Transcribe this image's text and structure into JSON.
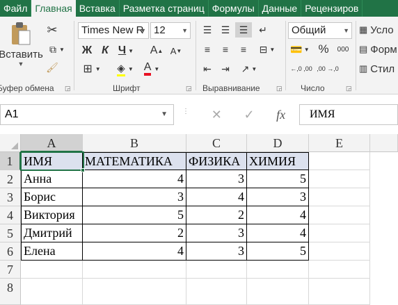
{
  "tabs": [
    "Файл",
    "Главная",
    "Вставка",
    "Разметка страниц",
    "Формулы",
    "Данные",
    "Рецензиров"
  ],
  "clipboard": {
    "paste_label": "Вставить",
    "group_label": "Буфер обмена"
  },
  "font": {
    "name": "Times New R",
    "size": "12",
    "bold": "Ж",
    "italic": "К",
    "underline": "Ч",
    "grow": "A",
    "shrink": "A",
    "color_letter": "A",
    "group_label": "Шрифт",
    "font_color": "#e81123"
  },
  "alignment": {
    "group_label": "Выравнивание"
  },
  "number": {
    "format": "Общий",
    "percent": "%",
    "comma": "000",
    "inc_dec": "←,0 ,00",
    "dec_dec": ",00 →,0",
    "group_label": "Число"
  },
  "styles": {
    "item1": "Усло",
    "item2": "Форм",
    "item3": "Стил"
  },
  "formula_bar": {
    "name_box": "A1",
    "cancel": "✕",
    "enter": "✓",
    "fx": "fx",
    "content": "ИМЯ"
  },
  "columns": [
    "A",
    "B",
    "C",
    "D",
    "E"
  ],
  "rows": [
    "1",
    "2",
    "3",
    "4",
    "5",
    "6",
    "7",
    "8"
  ],
  "table": {
    "headers": [
      "ИМЯ",
      "МАТЕМАТИКА",
      "ФИЗИКА",
      "ХИМИЯ"
    ],
    "data": [
      [
        "Анна",
        "4",
        "3",
        "5"
      ],
      [
        "Борис",
        "3",
        "4",
        "3"
      ],
      [
        "Виктория",
        "5",
        "2",
        "4"
      ],
      [
        "Дмитрий",
        "2",
        "3",
        "4"
      ],
      [
        "Елена",
        "4",
        "3",
        "5"
      ]
    ]
  },
  "colors": {
    "accent": "#217346",
    "header_fill": "#dce1ee"
  }
}
